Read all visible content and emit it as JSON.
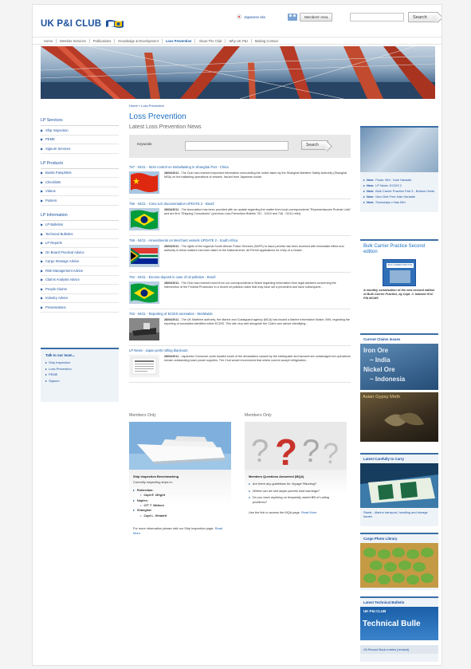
{
  "header": {
    "logo_text": "UK P&I CLUB",
    "lang_link": "Japanese site",
    "members_area": "Members' Area",
    "search_button": "Search"
  },
  "nav": [
    "Home",
    "Member Services",
    "Publications",
    "Knowledge & Development",
    "Loss Prevention",
    "About The Club",
    "Why UK P&I",
    "Making Contact"
  ],
  "sidebar": {
    "sections": [
      {
        "heading": "LP Services",
        "items": [
          "Ship Inspection",
          "PEME",
          "Signum Services"
        ]
      },
      {
        "heading": "LP Products",
        "items": [
          "Books Pamphlets",
          "Checklists",
          "Videos",
          "Posters"
        ]
      },
      {
        "heading": "LP Information",
        "items": [
          "LP Bulletins",
          "Technical Bulletins",
          "LP Reports",
          "On Board Practical Advice",
          "Cargo Stowage Advice",
          "Risk Management Advice",
          "Claims Analysis Advice",
          "People Claims",
          "Industry Advice",
          "Presentations"
        ]
      }
    ],
    "talk": {
      "title": "Talk to our team...",
      "items": [
        "Ship Inspection",
        "Loss Prevention",
        "PEME",
        "Signum"
      ]
    }
  },
  "main": {
    "breadcrumb": "Home » Loss Prevention",
    "title": "Loss Prevention",
    "subtitle": "Latest Loss Prevention News",
    "keywords_label": "Keywords",
    "search_button": "Search",
    "news": [
      {
        "head": "757 - 04/11 - Strict control on Deballasting in Shanghai Port - China",
        "date": "28/04/2011",
        "text": "- The Club has received important information surrounding the notice taken by the Shanghai Maritime Safety Authority (Shanghai MSA) on the ballasting operations of vessels. Issued from Japanese ocean.",
        "thumb": "china"
      },
      {
        "head": "756 - 04/11 - Crew ILO documentation UPDATE 2 - Brazil",
        "date": "28/04/2011",
        "text": "- The Association has been provided with an update regarding the matter from local correspondents \"Representacoes Proinde Ltda\" and are firm \"Shipping Consultores\" (previous Loss Prevention Bulletin 751 - 10/10 and 746 - 02/11 refer).",
        "thumb": "brazil"
      },
      {
        "head": "755 - 04/11 - Amendments on Merchant vessels UPDATE 2 - South Africa",
        "date": "28/04/2011",
        "text": "- The rights of the regional South African Police Services (SAPS) to issue permits has been received with immediate effect and authority in these matters has been taken to the National level. All Permit applications for entry of a vessel...",
        "thumb": "sa"
      },
      {
        "head": "754 - 04/11 - Escrow deposit in case of oil pollution - Brazil",
        "date": "28/04/2011",
        "text": "- The Club has received word from our correspondents in Brazil regarding information from legal advisers concerning the intervention of the Federal Prosecutor in a recent oil pollution claim that may have set a precedent and have subsequent...",
        "thumb": "brazil"
      },
      {
        "head": "753 - 04/11 - Reporting of ECDIS anomalies - Worldwide",
        "date": "28/04/2011",
        "text": "- The UK Maritime authority, the Marine and Coastguard agency (MCA) has issued a Marine Information Notice, MIN, regarding the reporting of anomalies identified within ECDIS. This site very well alongside the Club's own advice identifying...",
        "thumb": "ship"
      },
      {
        "head": "LP News - Japan ports rolling blackouts",
        "date": "28/04/2011",
        "text": "- Japanese Consumer ports located south of the devastation caused by the earthquake and tsunami are undamaged but operations remain outstanding lower power supplies. The Club would recommend that where current accept refrigerated...",
        "thumb": "paper"
      }
    ],
    "members_left": {
      "label": "Members Only",
      "title": "Ship Inspection Benchmarking",
      "sub": "Currently inspecting ships in:",
      "groups": [
        {
          "name": "Rotterdam:",
          "person": "Capt E. Wright"
        },
        {
          "name": "Naples:",
          "person": "CIT T. Watson"
        },
        {
          "name": "Shanghai:",
          "person": "Capt L. Hindarti"
        }
      ],
      "footer": "For more information please visit our Ship Inspection page.",
      "read_more": "Read More"
    },
    "members_right": {
      "label": "Members Only",
      "title": "Members Questions Answered (MQA)",
      "questions": [
        "Are there any guidelines for Voyage Planning?",
        "Where can we see larger parcels hold warnings?",
        "Do you have anything on frequently asked Bill of Lading problems?"
      ],
      "footer": "Use the link to access the MQA page.",
      "read_more": "Read More"
    }
  },
  "right": {
    "new_items": [
      {
        "tag": "New:",
        "text": "Posts: 969 - Kale Hariadie"
      },
      {
        "tag": "New:",
        "text": "LP News: ECDIS 2"
      },
      {
        "tag": "New:",
        "text": "Bulk Carrier Practice Part 3 - Bottom Holds"
      },
      {
        "tag": "New:",
        "text": "Nom Diet Free Kale Hariadie"
      },
      {
        "tag": "New:",
        "text": "Snowways v Nas Kitri"
      }
    ],
    "bulk": {
      "title": "Bulk Carrier Practice Second edition",
      "book_title": "BULK CARRIER PRACTICE",
      "text": "A monthly serialisation of the new second edition of Bulk Carrier Practice, by Capt. J. Isbester ExC FNI MCMS"
    },
    "claims": {
      "title": "Current Claims Issues",
      "img1_lines": [
        "Iron Ore",
        "~ India",
        "Nickel Ore",
        "~ Indonesia"
      ],
      "img2_text": "Asian Gypsy Moth"
    },
    "carefully": {
      "title": "Latest Carefully to Carry",
      "text": "Sisals - Marine transport, handling and storage issues"
    },
    "cargo": {
      "title": "Cargo Photo Library"
    },
    "tech": {
      "title": "Latest Technical Bulletin",
      "brand": "UK P&I CLUB",
      "img_text": "Technical Bulle",
      "footer": "Oil Record Book entries (revised)"
    }
  },
  "colors": {
    "brand_blue": "#1a4f9e",
    "link_blue": "#1a5fa8",
    "accent": "#3a6ea5"
  }
}
